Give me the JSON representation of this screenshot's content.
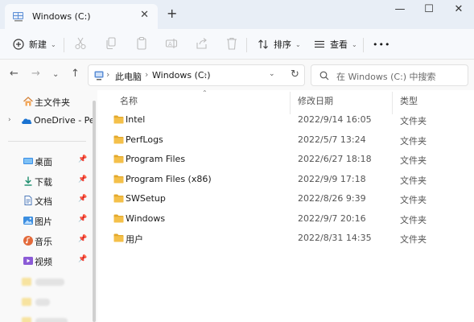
{
  "window": {
    "tab_title": "Windows (C:)",
    "new_tab": "+",
    "tab_close": "✕",
    "minimize": "—",
    "maximize": "☐",
    "close": "✕"
  },
  "toolbar": {
    "new_label": "新建",
    "sort_label": "排序",
    "view_label": "查看",
    "more_label": "•••",
    "icons": [
      "cut-icon",
      "copy-icon",
      "paste-icon",
      "rename-icon",
      "share-icon",
      "delete-icon"
    ]
  },
  "address": {
    "crumbs": [
      "此电脑",
      "Windows (C:)"
    ],
    "separator": "›",
    "dropdown": "⌄",
    "refresh": "↻"
  },
  "search": {
    "placeholder": "在 Windows (C:) 中搜索"
  },
  "sidebar": {
    "items": [
      {
        "label": "主文件夹",
        "icon": "home-icon"
      },
      {
        "label": "OneDrive - Per",
        "icon": "onedrive-icon"
      },
      {
        "label": "桌面",
        "icon": "desktop-icon",
        "pin": "📌"
      },
      {
        "label": "下载",
        "icon": "download-icon",
        "pin": "📌"
      },
      {
        "label": "文档",
        "icon": "documents-icon",
        "pin": "📌"
      },
      {
        "label": "图片",
        "icon": "pictures-icon",
        "pin": "📌"
      },
      {
        "label": "音乐",
        "icon": "music-icon",
        "pin": "📌"
      },
      {
        "label": "视频",
        "icon": "videos-icon",
        "pin": "📌"
      }
    ]
  },
  "columns": {
    "name": "名称",
    "modified": "修改日期",
    "type": "类型"
  },
  "files": [
    {
      "name": "Intel",
      "modified": "2022/9/14 16:05",
      "type": "文件夹"
    },
    {
      "name": "PerfLogs",
      "modified": "2022/5/7 13:24",
      "type": "文件夹"
    },
    {
      "name": "Program Files",
      "modified": "2022/6/27 18:18",
      "type": "文件夹"
    },
    {
      "name": "Program Files (x86)",
      "modified": "2022/9/9 17:18",
      "type": "文件夹"
    },
    {
      "name": "SWSetup",
      "modified": "2022/8/26 9:39",
      "type": "文件夹"
    },
    {
      "name": "Windows",
      "modified": "2022/9/7 20:16",
      "type": "文件夹"
    },
    {
      "name": "用户",
      "modified": "2022/8/31 14:35",
      "type": "文件夹"
    }
  ],
  "colors": {
    "folder": "#f4c04a",
    "folder_dark": "#e3a92c",
    "accent": "#0067c0",
    "tabbar": "#e8eef6"
  }
}
